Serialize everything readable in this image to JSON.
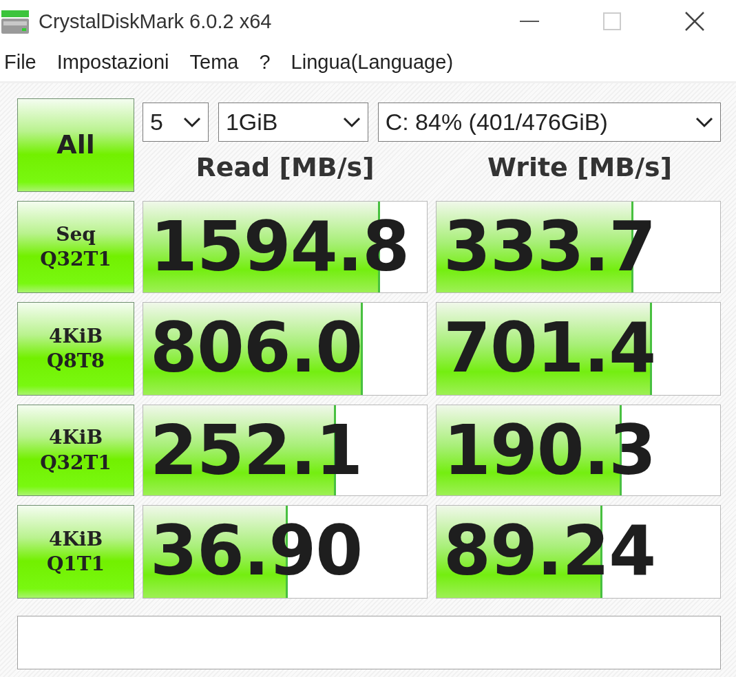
{
  "window": {
    "title": "CrystalDiskMark 6.0.2 x64"
  },
  "menu": [
    "File",
    "Impostazioni",
    "Tema",
    "?",
    "Lingua(Language)"
  ],
  "all_button": "All",
  "selectors": [
    {
      "kind": "count",
      "value": "5"
    },
    {
      "kind": "size",
      "value": "1GiB"
    },
    {
      "kind": "drive",
      "value": "C: 84% (401/476GiB)"
    }
  ],
  "headers": [
    "Read [MB/s]",
    "Write [MB/s]"
  ],
  "tests": [
    {
      "label": "Seq",
      "sublabel": "Q32T1",
      "read": {
        "value": "1594.8",
        "level": 0.836
      },
      "write": {
        "value": "333.7",
        "level": 0.693
      }
    },
    {
      "label": "4KiB",
      "sublabel": "Q8T8",
      "read": {
        "value": "806.0",
        "level": 0.775
      },
      "write": {
        "value": "701.4",
        "level": 0.76
      }
    },
    {
      "label": "4KiB",
      "sublabel": "Q32T1",
      "read": {
        "value": "252.1",
        "level": 0.68
      },
      "write": {
        "value": "190.3",
        "level": 0.652
      }
    },
    {
      "label": "4KiB",
      "sublabel": "Q1T1",
      "read": {
        "value": "36.90",
        "level": 0.51
      },
      "write": {
        "value": "89.24",
        "level": 0.585
      }
    }
  ]
}
